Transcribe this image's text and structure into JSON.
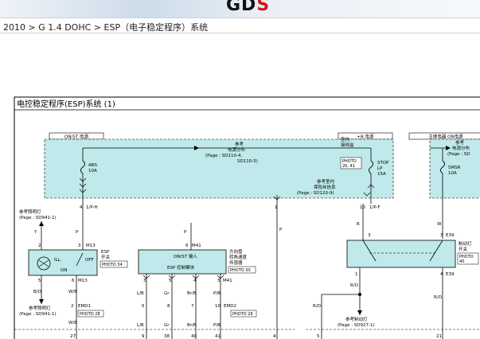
{
  "header": {
    "logo_main": "GD",
    "logo_accent": "S",
    "breadcrumb": "2010 > G 1.4 DOHC > ESP（电子稳定程序）系统"
  },
  "diagram": {
    "title": "电控稳定程序(ESP)系统 (1)",
    "power_labels": {
      "on_st": "ON/ST 电源",
      "b_plus": "+B 电源",
      "main_relay": "主继电器 ON电源"
    },
    "ref_power_1": "参考",
    "ref_power_2": "电源分布",
    "ref_power_3": "(Page : SD110-4,",
    "ref_power_4": "SD110-5)",
    "fuse_abs_name": "ABS",
    "fuse_abs_amp": "10A",
    "indoor_box_1": "室内",
    "indoor_box_2": "接线盒",
    "photo_26_41_a": "PHOTO",
    "photo_26_41_b": "26, 41",
    "fuse_stop_1": "STOP",
    "fuse_stop_2": "LP",
    "fuse_stop_3": "15A",
    "ref_indoor_1": "参考室内",
    "ref_indoor_2": "保险丝信息",
    "ref_indoor_3": "(Page : SD120-9)",
    "ref_power_r1": "参考",
    "ref_power_r2": "电源分布",
    "ref_power_r3": "(Page : SD",
    "fuse_smsr_1": "SMSR",
    "fuse_smsr_2": "10A",
    "w_ip_h": "1/P-H",
    "w_ip_f": "1/P-F",
    "ref_lighting_1": "参考照明灯",
    "ref_lighting_2": "(Page : SD941-1)",
    "m13": "M13",
    "ill": "ILL.",
    "on": "ON",
    "off": "OFF",
    "esp_switch_1": "ESP",
    "esp_switch_2": "开关",
    "photo34": "PHOTO 34",
    "m41": "M41",
    "onst_input": "ON/ST 输入",
    "esp_module": "ESP 控制模块",
    "steer_1": "方向盘",
    "steer_2": "转角速度",
    "steer_3": "传感器",
    "photo30": "PHOTO 30",
    "e39": "E39",
    "brake_sw_1": "制动灯",
    "brake_sw_2": "开关",
    "photo40_a": "PHOTO",
    "photo40_b": "40",
    "emd1": "EMD1",
    "photo28": "PHOTO 28",
    "emd2": "EMD2",
    "ref_brake_1": "参考制动灯",
    "ref_brake_2": "(Page : SD927-1)",
    "ref_lighting_3": "参考照明灯",
    "ref_lighting_4": "(Page : SD941-1)",
    "w_y": "Y",
    "w_p": "P",
    "w_w": "W",
    "w_r": "R",
    "w_bo": "B/O",
    "w_wb": "W/B",
    "w_lb": "L/B",
    "w_gr": "Gr",
    "w_brb": "Br/B",
    "w_pb": "P/B",
    "w_ro": "R/O",
    "pin_1": "1",
    "pin_2": "2",
    "pin_3": "3",
    "pin_4": "4",
    "pin_5": "5",
    "pin_6": "6",
    "pin_7": "7",
    "pin_8": "8",
    "pin_9": "9",
    "pin_10": "10",
    "pin_18": "18",
    "pin_21": "21",
    "pin_27": "27",
    "pin_38": "38",
    "pin_39": "39",
    "pin_40": "40",
    "pin_41": "41"
  }
}
